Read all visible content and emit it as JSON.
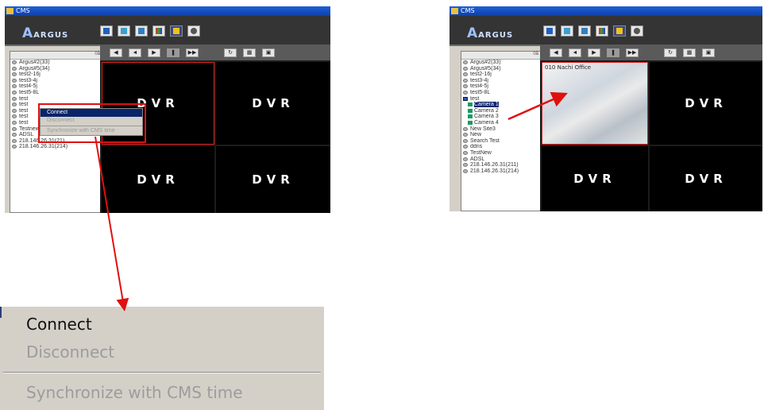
{
  "left_window": {
    "title": "CMS",
    "logo": "ARGUS",
    "tree_header": "0å",
    "tree_items": [
      "Argus#2(33)",
      "Argus#5(34)",
      "test2-16j",
      "test3-4j",
      "test4-5j",
      "test5-8L",
      "test",
      "test",
      "test",
      "test",
      "test",
      "Testnew",
      "ADSL",
      "218.146.26.31(21)",
      "218.146.26.31(214)"
    ],
    "context_menu": [
      "Connect",
      "Disconnect",
      "Synchronize with CMS time"
    ],
    "cells": [
      "DVR",
      "DVR",
      "DVR",
      "DVR"
    ]
  },
  "right_window": {
    "title": "CMS",
    "logo": "ARGUS",
    "tree_header": "0å",
    "tree_items": [
      "Argus#2(33)",
      "Argus#5(34)",
      "test2-16j",
      "test3-4j",
      "test4-5j",
      "test5-8L",
      "test"
    ],
    "cameras": [
      "Camera 1",
      "Camera 2",
      "Camera 3",
      "Camera 4"
    ],
    "tree_items_after": [
      "New Site3",
      "New",
      "Search Test",
      "ddns",
      "TestNew",
      "ADSL",
      "218.146.26.31(211)",
      "218.146.26.31(214)"
    ],
    "video_label": "010 Nachi Office",
    "cells": [
      "DVR",
      "DVR",
      "DVR"
    ]
  },
  "zoom_menu": {
    "connect": "Connect",
    "disconnect": "Disconnect",
    "sync": "Synchronize with CMS time"
  },
  "colors": {
    "arrow": "#e01010",
    "toolbar": "#343434",
    "menu_bg": "#d4d0c8",
    "selection": "#0a246a"
  }
}
